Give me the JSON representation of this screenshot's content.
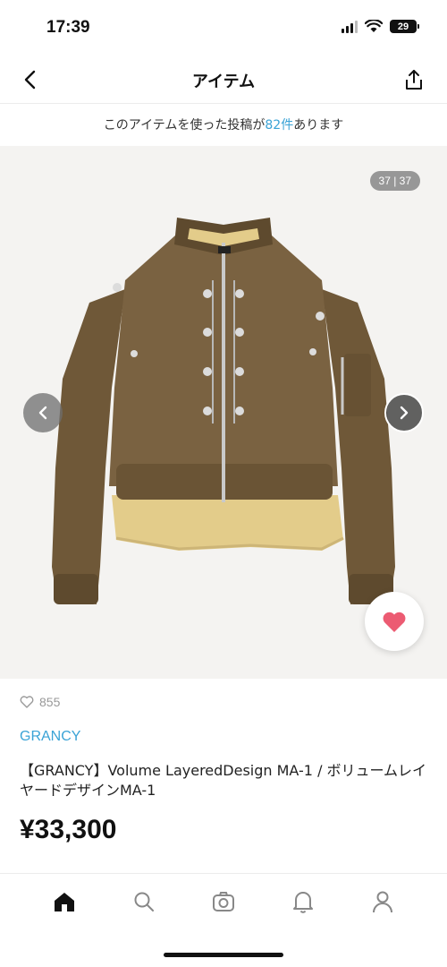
{
  "status_bar": {
    "time": "17:39",
    "battery": "29"
  },
  "header": {
    "title": "アイテム"
  },
  "notice": {
    "prefix": "このアイテムを使った投稿が",
    "count": "82件",
    "suffix": "あります"
  },
  "gallery": {
    "counter": "37 | 37"
  },
  "product": {
    "likes": "855",
    "brand": "GRANCY",
    "name": "【GRANCY】Volume LayeredDesign MA-1 / ボリュームレイヤードデザインMA-1",
    "price": "¥33,300"
  },
  "icons": [
    "back-icon",
    "share-icon",
    "chevron-left-icon",
    "chevron-right-icon",
    "heart-icon",
    "home-icon",
    "search-icon",
    "camera-icon",
    "bell-icon",
    "user-icon"
  ],
  "colors": {
    "accent": "#3aa3d6",
    "heart": "#ec5b72"
  }
}
